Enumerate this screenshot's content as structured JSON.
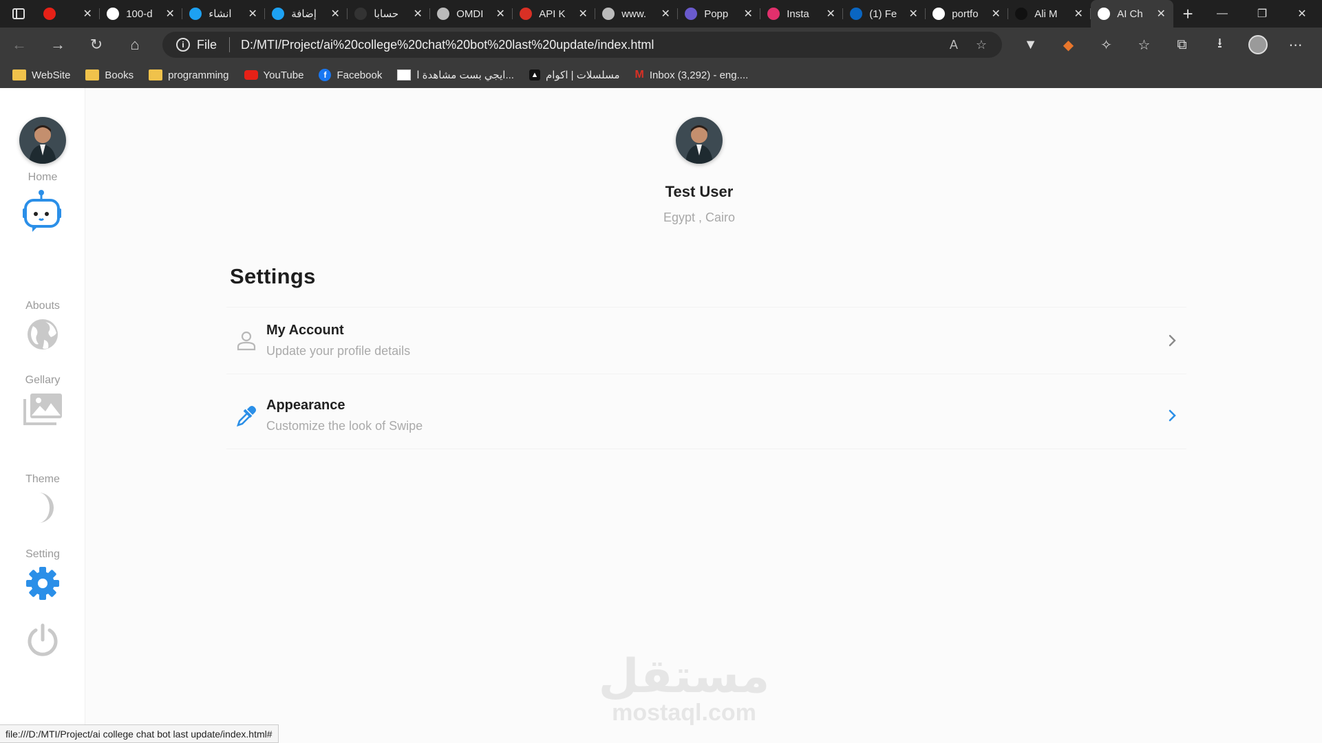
{
  "browser": {
    "tabs": [
      {
        "title": "",
        "icon": "youtube-icon",
        "color": "#e62117"
      },
      {
        "title": "100-d",
        "icon": "github-icon",
        "color": "#ffffff"
      },
      {
        "title": "انشاء",
        "icon": "circle-app-icon",
        "color": "#1da1f2"
      },
      {
        "title": "إضافة",
        "icon": "circle-app-icon",
        "color": "#1da1f2"
      },
      {
        "title": "حسابا",
        "icon": "dark-circle-icon",
        "color": "#333333"
      },
      {
        "title": "OMDI",
        "icon": "globe-icon",
        "color": "#bbbbbb"
      },
      {
        "title": "API K",
        "icon": "gmail-icon",
        "color": "#d93025"
      },
      {
        "title": "www.",
        "icon": "globe-icon",
        "color": "#bbbbbb"
      },
      {
        "title": "Popp",
        "icon": "poppins-icon",
        "color": "#6a5acd"
      },
      {
        "title": "Insta",
        "icon": "instagram-icon",
        "color": "#e1306c"
      },
      {
        "title": "(1) Fe",
        "icon": "linkedin-icon",
        "color": "#0a66c2"
      },
      {
        "title": "portfo",
        "icon": "google-icon",
        "color": "#ffffff"
      },
      {
        "title": "Ali M",
        "icon": "a-logo-icon",
        "color": "#111111"
      },
      {
        "title": "AI Ch",
        "icon": "robot-tab-icon",
        "color": "#ffffff",
        "active": true
      }
    ],
    "address": {
      "scheme": "File",
      "url": "D:/MTI/Project/ai%20college%20chat%20bot%20last%20update/index.html"
    },
    "bookmarks": [
      {
        "label": "WebSite",
        "icon": "folder-icon"
      },
      {
        "label": "Books",
        "icon": "folder-icon"
      },
      {
        "label": "programming",
        "icon": "folder-icon"
      },
      {
        "label": "YouTube",
        "icon": "youtube-icon"
      },
      {
        "label": "Facebook",
        "icon": "facebook-icon"
      },
      {
        "label": "ايجي بست مشاهدة ا...",
        "icon": "egybest-icon"
      },
      {
        "label": "مسلسلات | اكوام",
        "icon": "akwam-icon"
      },
      {
        "label": "Inbox (3,292) - eng....",
        "icon": "gmail-icon"
      }
    ],
    "status_url": "file:///D:/MTI/Project/ai college chat bot last update/index.html#"
  },
  "sidebar": {
    "items": [
      {
        "label": "Home",
        "icon": "robot-icon"
      },
      {
        "label": "Abouts",
        "icon": "globe-icon"
      },
      {
        "label": "Gellary",
        "icon": "gallery-icon"
      },
      {
        "label": "Theme",
        "icon": "moon-icon"
      },
      {
        "label": "Setting",
        "icon": "gear-icon"
      },
      {
        "label": "",
        "icon": "power-icon"
      }
    ]
  },
  "profile": {
    "name": "Test User",
    "location": "Egypt , Cairo"
  },
  "settings": {
    "title": "Settings",
    "options": [
      {
        "title": "My Account",
        "subtitle": "Update your profile details",
        "icon": "user-icon"
      },
      {
        "title": "Appearance",
        "subtitle": "Customize the look of Swipe",
        "icon": "eyedropper-icon"
      }
    ]
  },
  "watermark": {
    "arabic": "مستقل",
    "latin": "mostaql.com"
  },
  "colors": {
    "accent": "#2b8fe8",
    "muted": "#a8a8a8",
    "text": "#222222"
  }
}
